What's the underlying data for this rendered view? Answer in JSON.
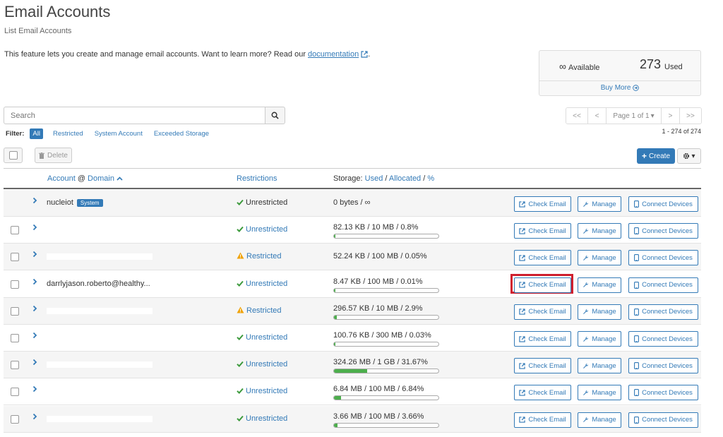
{
  "page": {
    "title": "Email Accounts",
    "subtitle": "List Email Accounts",
    "intro_text": "This feature lets you create and manage email accounts. Want to learn more? Read our ",
    "doc_link": "documentation",
    "intro_end": "."
  },
  "stats": {
    "available_symbol": "∞",
    "available_label": "Available",
    "used_count": "273",
    "used_label": "Used",
    "buy_more": "Buy More"
  },
  "search": {
    "placeholder": "Search"
  },
  "pager": {
    "first": "<<",
    "prev": "<",
    "page_label": "Page 1 of 1",
    "next": ">",
    "last": ">>",
    "count": "1 - 274 of 274"
  },
  "filter": {
    "label": "Filter:",
    "options": [
      "All",
      "Restricted",
      "System Account",
      "Exceeded Storage"
    ],
    "active": "All"
  },
  "toolbar": {
    "delete": "Delete",
    "create": "Create"
  },
  "table": {
    "headers": {
      "account": "Account",
      "at": "@",
      "domain": "Domain",
      "restrictions": "Restrictions",
      "storage_prefix": "Storage:",
      "used": "Used",
      "slash1": "/",
      "allocated": "Allocated",
      "slash2": "/",
      "percent": "%"
    },
    "buttons": {
      "check": "Check Email",
      "manage": "Manage",
      "connect": "Connect Devices"
    },
    "rows": [
      {
        "account": "nucleiot",
        "system_badge": "System",
        "restriction": "Unrestricted",
        "storage": "0 bytes / ∞",
        "fill": null
      },
      {
        "account": "",
        "restriction": "Unrestricted",
        "storage": "82.13 KB / 10 MB / 0.8%",
        "fill": 0.008
      },
      {
        "account": "",
        "restriction": "Restricted",
        "storage": "52.24 KB / 100 MB / 0.05%",
        "fill": null
      },
      {
        "account": "darrlyjason.roberto@healthy...",
        "restriction": "Unrestricted",
        "storage": "8.47 KB / 100 MB / 0.01%",
        "fill": 0.0001
      },
      {
        "account": "",
        "restriction": "Restricted",
        "storage": "296.57 KB / 10 MB / 2.9%",
        "fill": 0.029
      },
      {
        "account": "",
        "restriction": "Unrestricted",
        "storage": "100.76 KB / 300 MB / 0.03%",
        "fill": 0.0003
      },
      {
        "account": "",
        "restriction": "Unrestricted",
        "storage": "324.26 MB / 1 GB / 31.67%",
        "fill": 0.3167
      },
      {
        "account": "",
        "restriction": "Unrestricted",
        "storage": "6.84 MB / 100 MB / 6.84%",
        "fill": 0.0684
      },
      {
        "account": "",
        "restriction": "Unrestricted",
        "storage": "3.66 MB / 100 MB / 3.66%",
        "fill": 0.0366
      }
    ]
  },
  "colors": {
    "primary": "#337ab7",
    "success": "#3c9a3c",
    "warning": "#f0a30a",
    "highlight": "#d0202e"
  }
}
